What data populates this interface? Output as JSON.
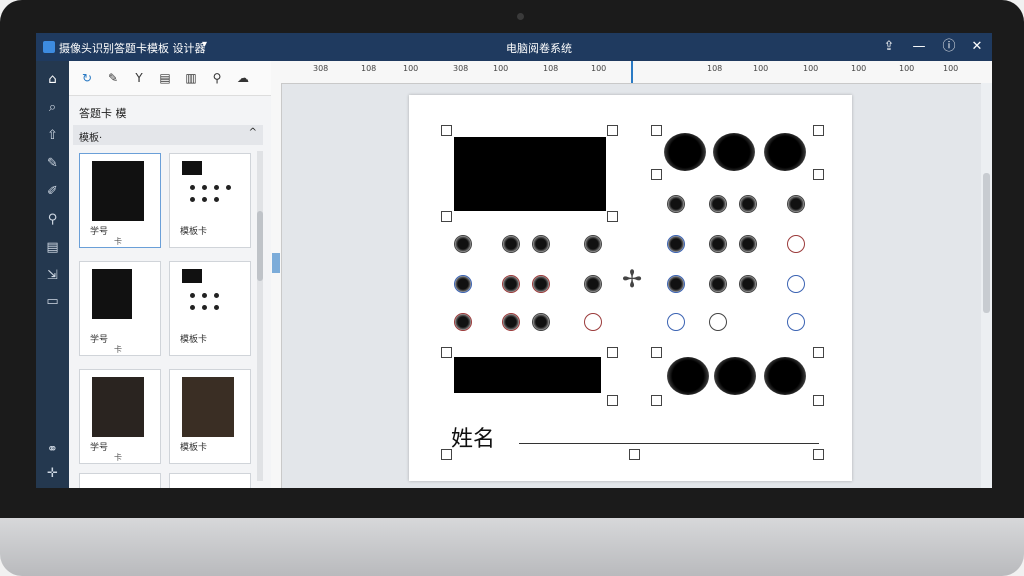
{
  "window": {
    "app_title": "摄像头识别答题卡模板 设计器",
    "center_title": "电脑阅卷系统",
    "controls": [
      "⇪",
      "—",
      "ⓘ",
      "✕"
    ]
  },
  "iconbar": [
    "home-icon",
    "search-icon",
    "upload-icon",
    "pen-icon",
    "brush-icon",
    "zoom-icon",
    "layers-icon",
    "export-icon",
    "archive-icon",
    "share-icon",
    "move-icon"
  ],
  "panel": {
    "header": "答题卡 模",
    "section_label": "模板·",
    "templates": [
      {
        "label": "学号",
        "sub": "卡"
      },
      {
        "label": "模板卡",
        "sub": ""
      },
      {
        "label": "学号",
        "sub": "卡"
      },
      {
        "label": "模板卡",
        "sub": ""
      },
      {
        "label": "学号",
        "sub": "卡"
      },
      {
        "label": "模板卡",
        "sub": ""
      }
    ]
  },
  "ruler": {
    "labels": [
      "308",
      "108",
      "100",
      "308",
      "100",
      "108",
      "100",
      "108",
      "100",
      "100",
      "100",
      "100",
      "100"
    ]
  },
  "document": {
    "name_label": "姓名"
  }
}
